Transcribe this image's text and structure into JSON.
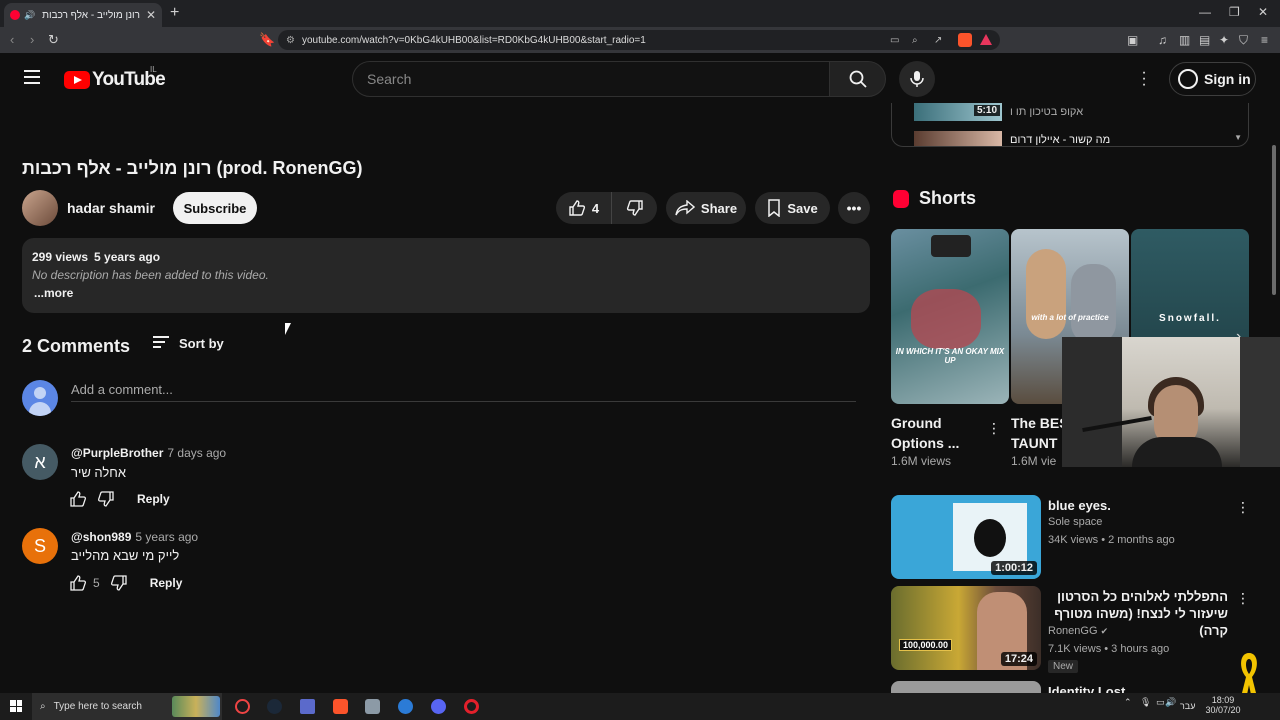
{
  "browser": {
    "tab_title": "רונן מולייב - אלף רכבות (GG",
    "url": "youtube.com/watch?v=0KbG4kUHB00&list=RD0KbG4kUHB00&start_radio=1"
  },
  "header": {
    "logo_text": "YouTube",
    "country": "IL",
    "search_placeholder": "Search",
    "signin": "Sign in"
  },
  "video": {
    "title": "רונן מולייב - אלף רכבות (prod. RonenGG)",
    "channel": "hadar shamir",
    "subscribe": "Subscribe",
    "likes": "4",
    "share": "Share",
    "save": "Save",
    "views": "299 views",
    "age": "5 years ago",
    "description": "No description has been added to this video.",
    "more": "...more"
  },
  "comments": {
    "count_label": "2 Comments",
    "sort_label": "Sort by",
    "add_placeholder": "Add a comment...",
    "items": [
      {
        "avatar_letter": "א",
        "avatar_color": "#455a64",
        "user": "@PurpleBrother",
        "time": "7 days ago",
        "text": "אחלה שיר",
        "likes": "",
        "reply": "Reply"
      },
      {
        "avatar_letter": "S",
        "avatar_color": "#e8710a",
        "user": "@shon989",
        "time": "5 years ago",
        "text": "לייק מי שבא מהלייב",
        "likes": "5",
        "reply": "Reply"
      }
    ]
  },
  "playlist": {
    "rows": [
      {
        "duration": "5:10",
        "title": "אקופ בטיכון תו ו"
      },
      {
        "title": "מה קשור - איילון דרום"
      }
    ]
  },
  "shorts": {
    "heading": "Shorts",
    "items": [
      {
        "caption": "IN WHICH IT'S AN OKAY MIX UP",
        "title": "Ground Options ...",
        "views": "1.6M views"
      },
      {
        "caption": "with a lot of practice",
        "title": "The BES TAUNT i",
        "views": "1.6M vie"
      },
      {
        "caption": "Snowfall.",
        "title": "",
        "views": ""
      }
    ]
  },
  "related": [
    {
      "title": "blue eyes.",
      "channel": "Sole space",
      "meta": "34K views • 2 months ago",
      "duration": "1:00:12"
    },
    {
      "title": "התפללתי לאלוהים כל הסרטון שיעזור לי לנצח! (משהו מטורף קרה)",
      "channel": "RonenGG",
      "meta": "7.1K views • 3 hours ago",
      "duration": "17:24",
      "badge": "New",
      "thumb_text": "100,000.00"
    },
    {
      "title": "Identity Lost"
    }
  ],
  "taskbar": {
    "search": "Type here to search",
    "lang": "עבר",
    "time": "18:09",
    "date": "30/07/20"
  }
}
